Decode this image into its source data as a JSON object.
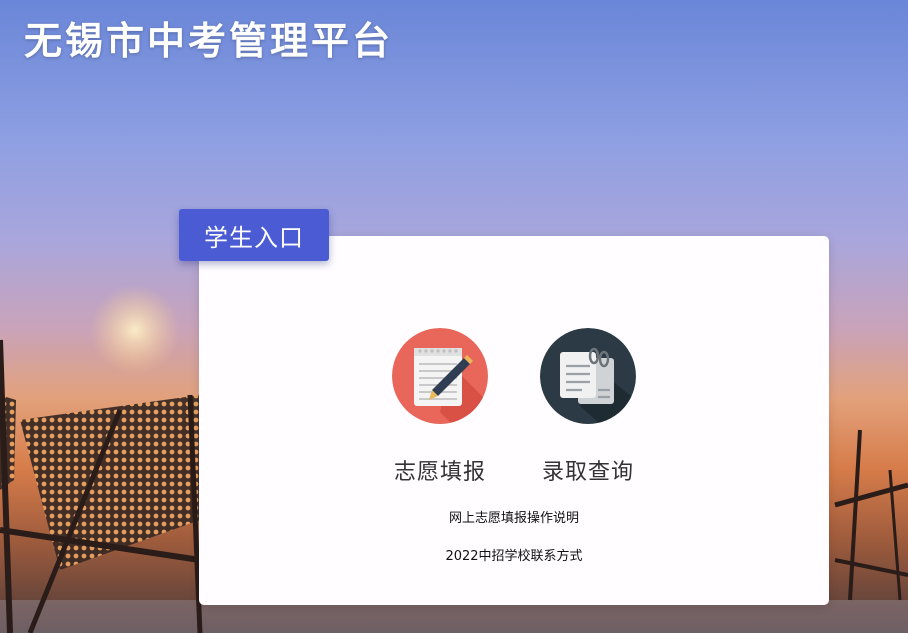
{
  "header": {
    "title": "无锡市中考管理平台"
  },
  "entry": {
    "label": "学生入口"
  },
  "actions": [
    {
      "label": "志愿填报",
      "icon": "notepad-pen-icon",
      "color": "#e9665a"
    },
    {
      "label": "录取查询",
      "icon": "documents-clip-icon",
      "color": "#2b3a44"
    }
  ],
  "links": [
    {
      "label": "网上志愿填报操作说明"
    },
    {
      "label": "2022中招学校联系方式"
    }
  ]
}
